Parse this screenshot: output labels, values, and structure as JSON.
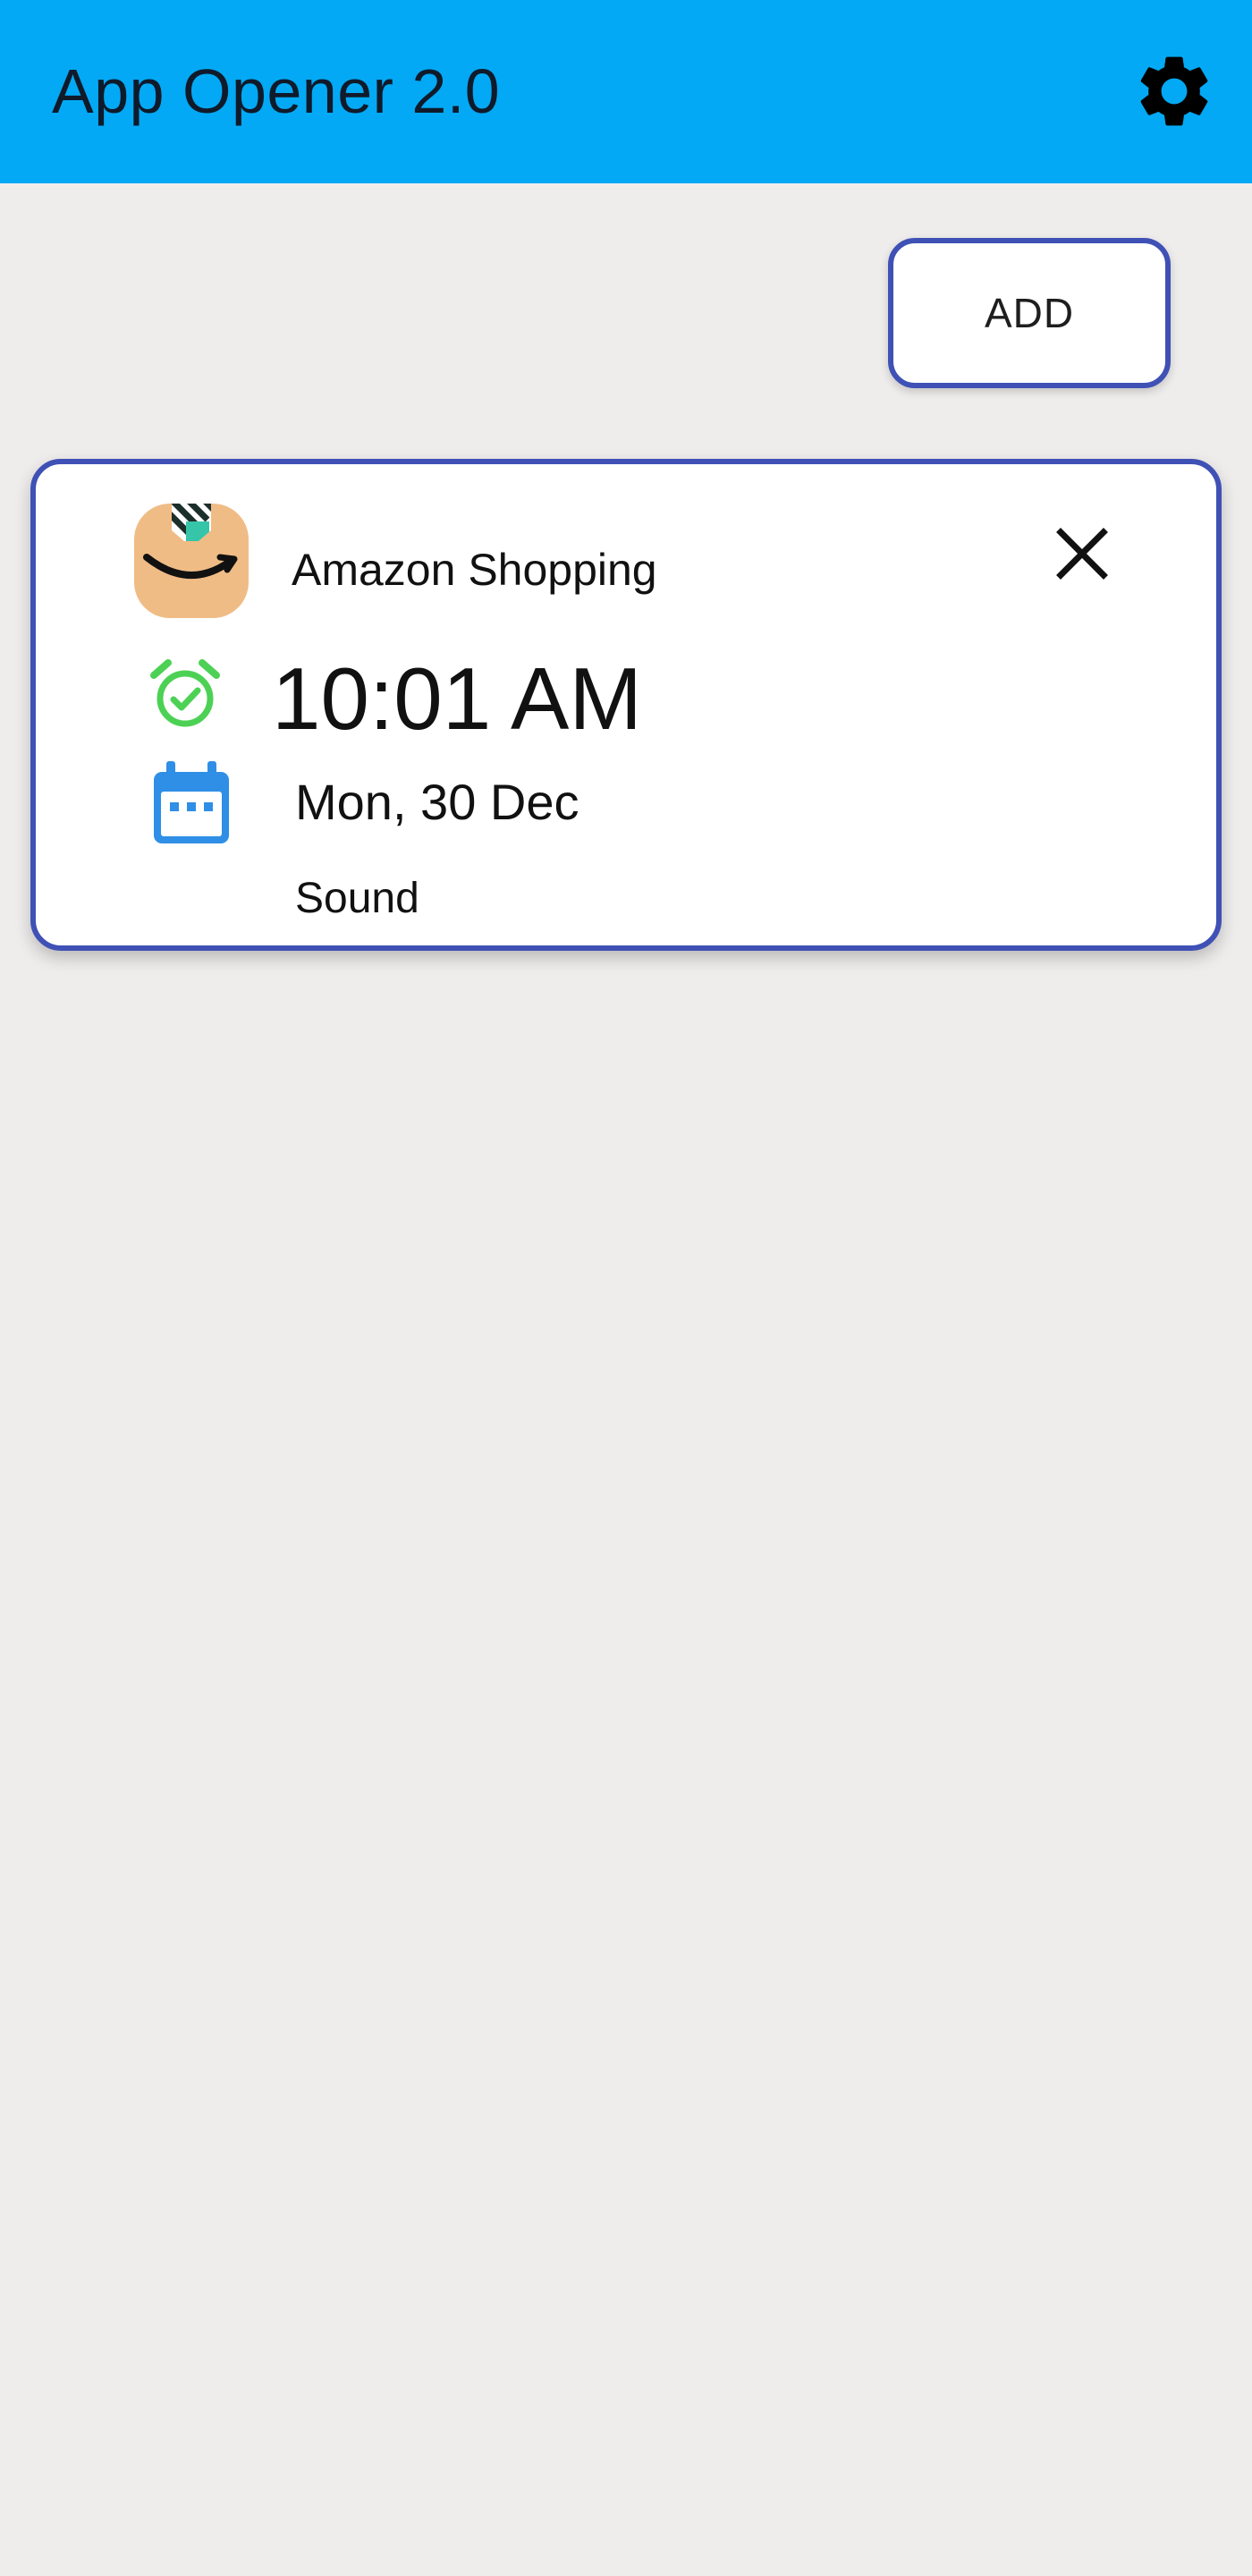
{
  "app_bar": {
    "title": "App Opener 2.0",
    "background": "#03a9f4",
    "settings_icon": "gear-icon"
  },
  "toolbar": {
    "add_label": "ADD"
  },
  "schedules": [
    {
      "app_name": "Amazon Shopping",
      "app_icon": "amazon-shopping-icon",
      "time": "10:01 AM",
      "date": "Mon, 30 Dec",
      "mode": "Sound",
      "alarm_icon": "alarm-check-icon",
      "calendar_icon": "calendar-icon",
      "close_icon": "close-icon"
    }
  ],
  "colors": {
    "accent": "#3f51b5",
    "alarm": "#4cd154",
    "calendar": "#2f8fe6",
    "page_background": "#efedec"
  }
}
